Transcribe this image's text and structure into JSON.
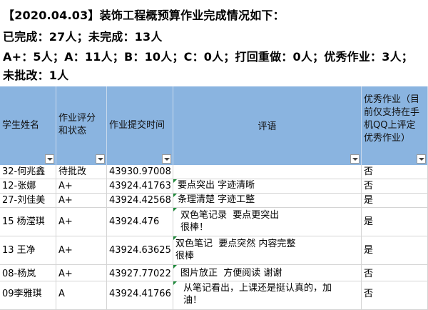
{
  "summary": {
    "line1": "【2020.04.03】装饰工程概预算作业完成情况如下：",
    "line2": "已完成：27人；未完成：13人",
    "line3": "A+：5人；A：11人；B：10人；C：0人；打回重做：0人；优秀作业：3人；",
    "line4": "未批改：1人"
  },
  "columns": [
    {
      "label": "学生姓名"
    },
    {
      "label": "作业评分\n和状态"
    },
    {
      "label": "作业提交时间"
    },
    {
      "label": "评语"
    },
    {
      "label": "优秀作业（目\n前仅支持在手\n机QQ上评定\n优秀作业）"
    }
  ],
  "rows": [
    {
      "name": "32-何兆鑫",
      "grade": "待批改",
      "time": "43930.97008",
      "comment": "",
      "excellent": "否"
    },
    {
      "name": "12-张娜",
      "grade": "A+",
      "time": "43924.41763",
      "comment": "要点突出 字迹清晰",
      "excellent": "否"
    },
    {
      "name": "27-刘佳美",
      "grade": "A+",
      "time": "43924.42568",
      "comment": "条理清楚 字迹工整",
      "excellent": "是"
    },
    {
      "name": "15 杨滢琪",
      "grade": "A+",
      "time": "43924.476",
      "comment": "双色笔记录  要点更突出\n很棒！",
      "excellent": "是"
    },
    {
      "name": "13 王净",
      "grade": "A+",
      "time": "43924.63625",
      "comment": "双色笔记  要点突然 内容完整\n很棒",
      "excellent": "是"
    },
    {
      "name": "08-杨岚",
      "grade": "A+",
      "time": "43927.77022",
      "comment": "图片放正  方便阅读 谢谢",
      "excellent": "否"
    },
    {
      "name": "09李雅琪",
      "grade": "A",
      "time": "43924.41766",
      "comment": "从笔记看出，上课还是挺认真的，加\n油！",
      "excellent": "否"
    }
  ]
}
